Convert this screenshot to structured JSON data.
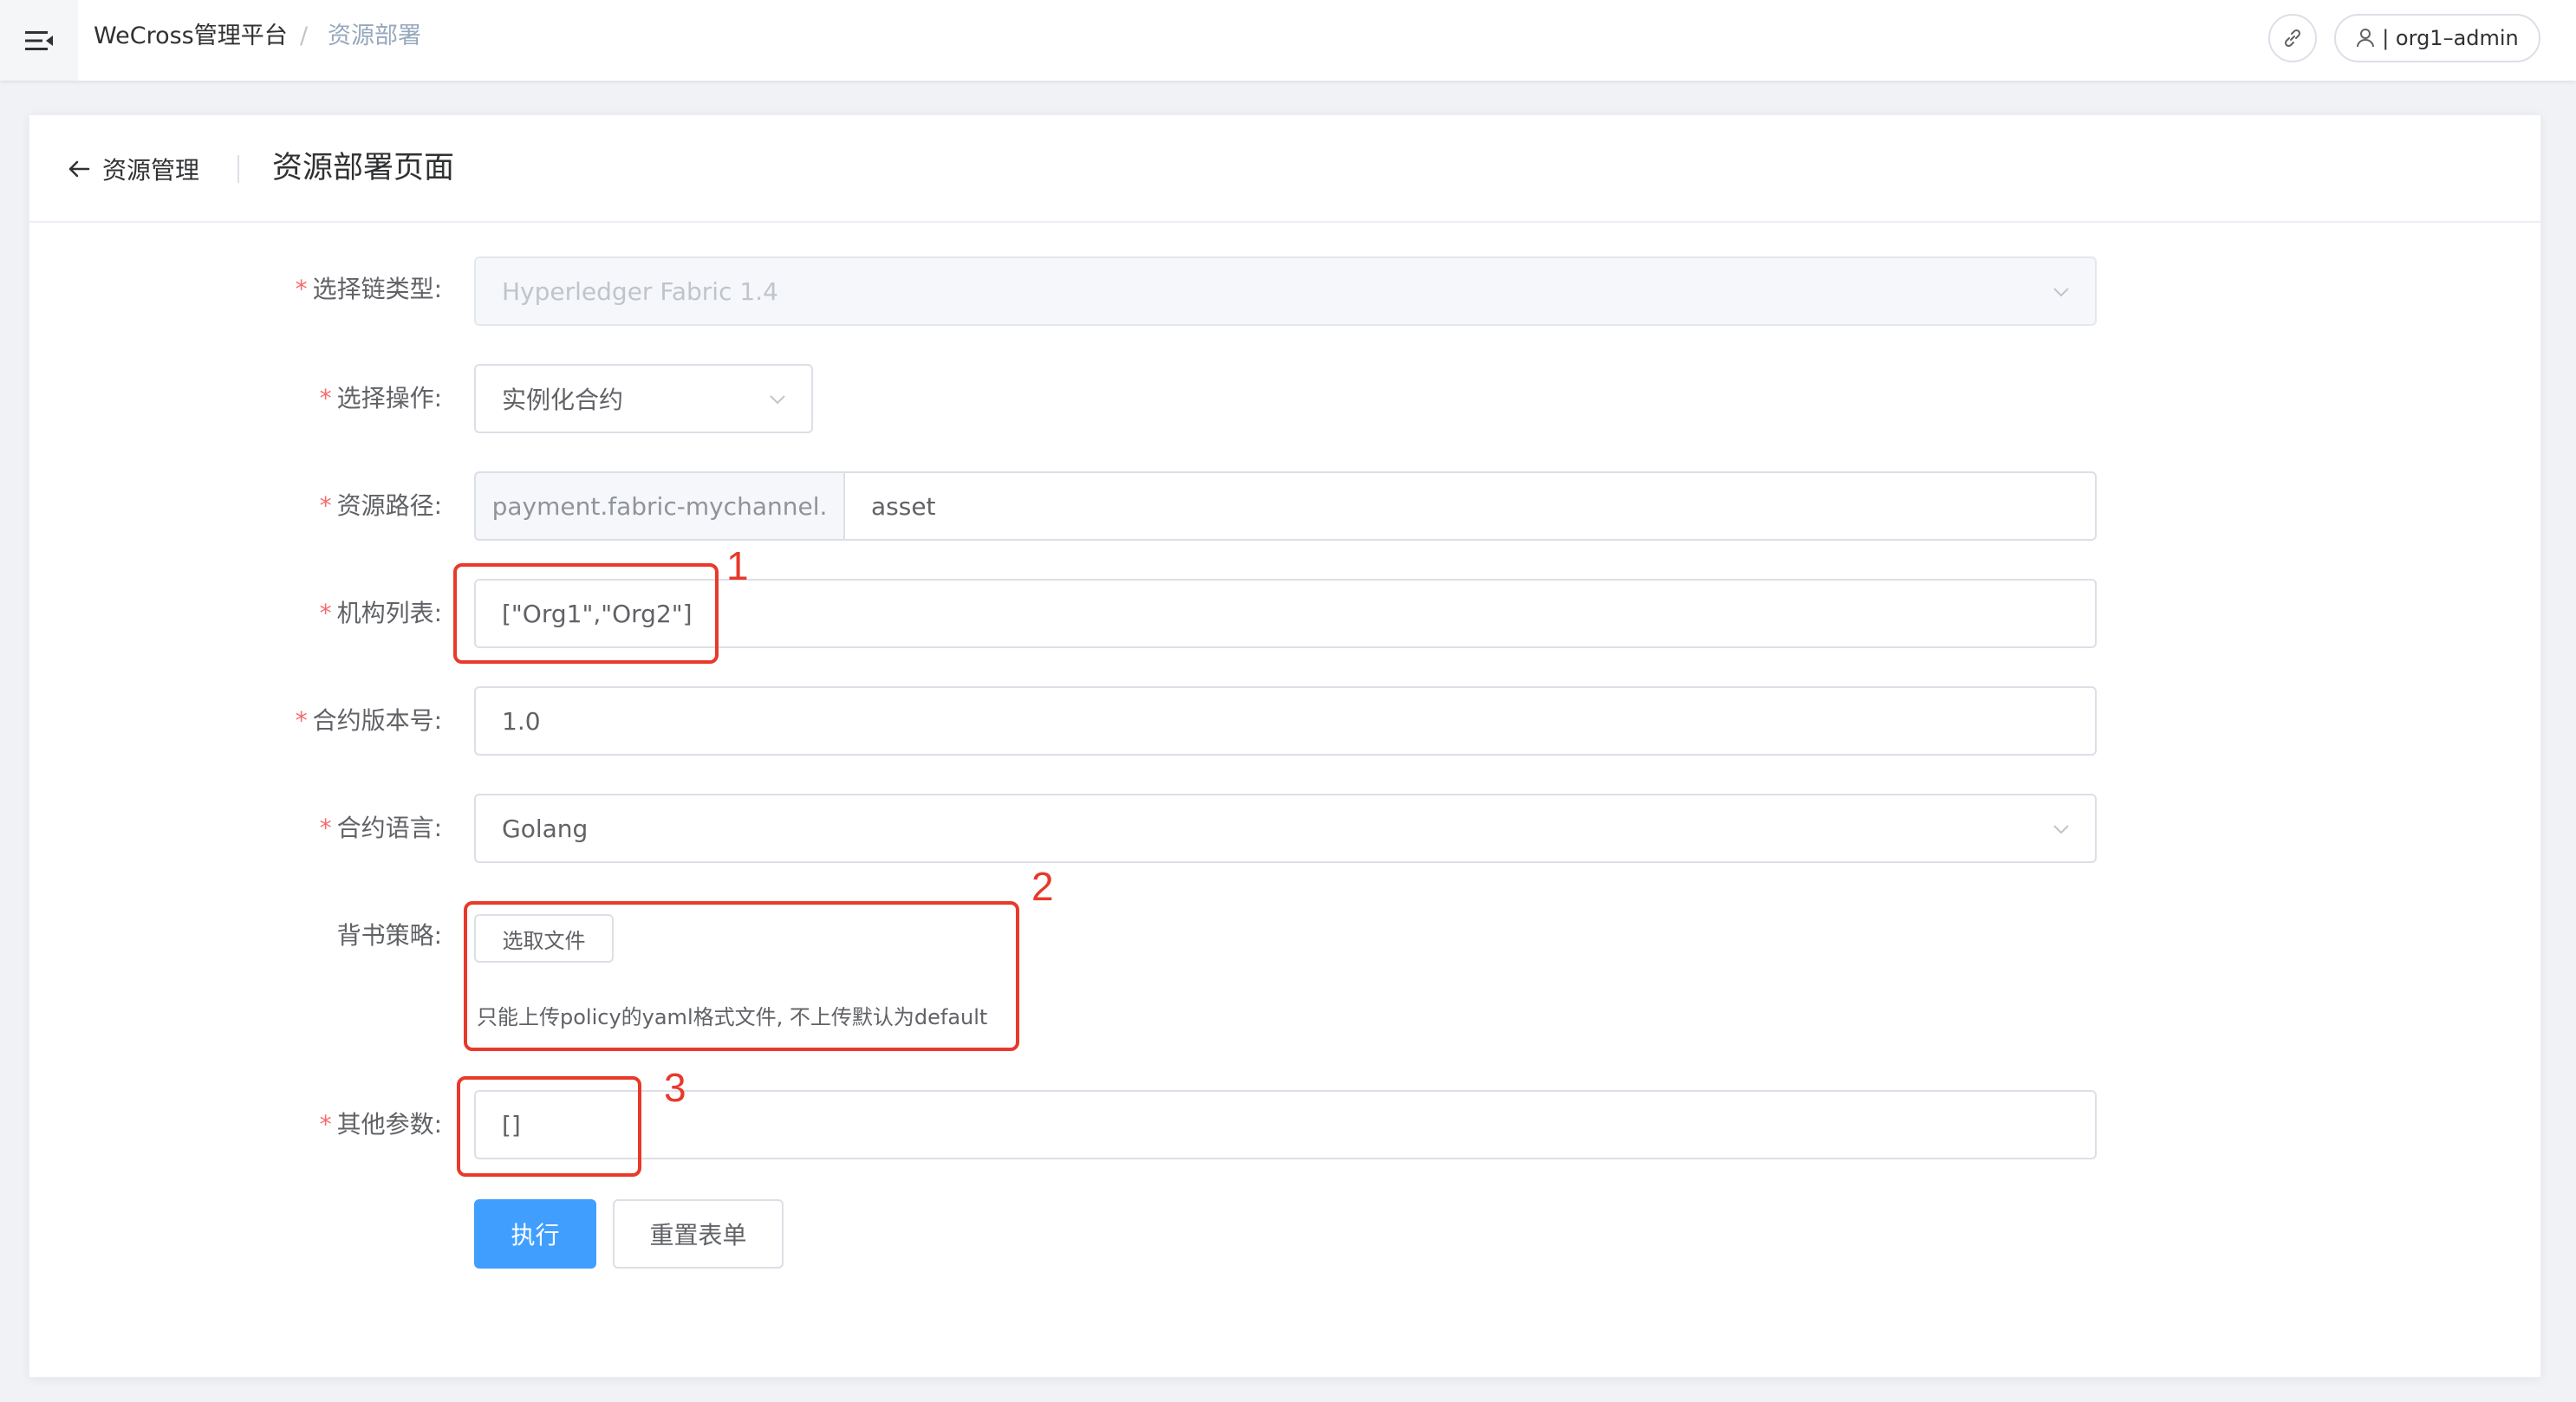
{
  "navbar": {
    "brand": "WeCross管理平台",
    "separator": "/",
    "breadcrumb": "资源部署",
    "user_label": "| org1–admin"
  },
  "header": {
    "back_label": "资源管理",
    "page_title": "资源部署页面"
  },
  "form": {
    "chain_type": {
      "required": "*",
      "label": "选择链类型:",
      "value": "Hyperledger Fabric 1.4",
      "disabled": true
    },
    "operation": {
      "required": "*",
      "label": "选择操作:",
      "value": "实例化合约"
    },
    "resource_path": {
      "required": "*",
      "label": "资源路径:",
      "prefix": "payment.fabric-mychannel.",
      "value": "asset"
    },
    "org_list": {
      "required": "*",
      "label": "机构列表:",
      "value": "[\"Org1\",\"Org2\"]"
    },
    "contract_version": {
      "required": "*",
      "label": "合约版本号:",
      "value": "1.0"
    },
    "contract_language": {
      "required": "*",
      "label": "合约语言:",
      "value": "Golang"
    },
    "endorsement_policy": {
      "label": "背书策略:",
      "button_label": "选取文件",
      "tip": "只能上传policy的yaml格式文件, 不上传默认为default"
    },
    "other_params": {
      "required": "*",
      "label": "其他参数:",
      "value": "[]"
    }
  },
  "actions": {
    "execute_label": "执行",
    "reset_label": "重置表单"
  },
  "annotations": [
    "1",
    "2",
    "3"
  ],
  "colors": {
    "primary": "#409eff",
    "required": "#f56c6c",
    "annotation": "#e8392a"
  }
}
